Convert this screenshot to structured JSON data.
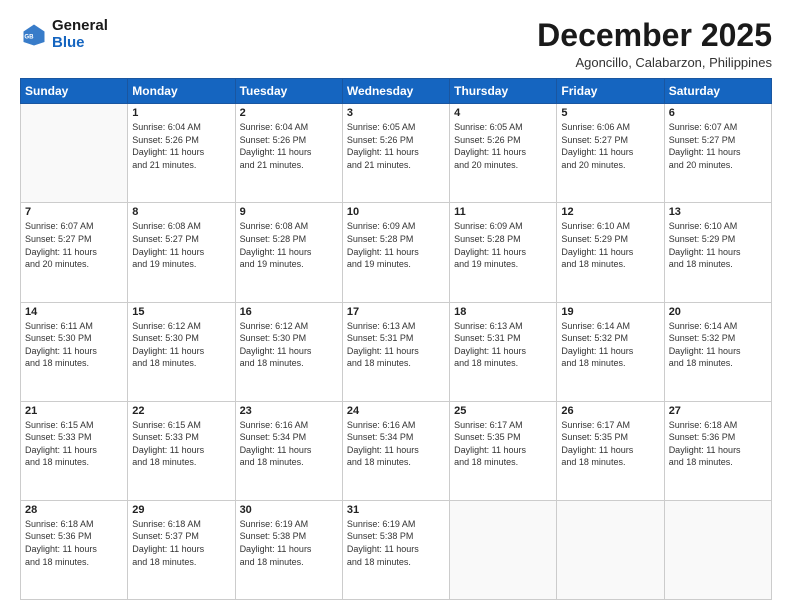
{
  "header": {
    "logo_general": "General",
    "logo_blue": "Blue",
    "month_title": "December 2025",
    "location": "Agoncillo, Calabarzon, Philippines"
  },
  "days_of_week": [
    "Sunday",
    "Monday",
    "Tuesday",
    "Wednesday",
    "Thursday",
    "Friday",
    "Saturday"
  ],
  "weeks": [
    [
      {
        "day": "",
        "info": ""
      },
      {
        "day": "1",
        "info": "Sunrise: 6:04 AM\nSunset: 5:26 PM\nDaylight: 11 hours\nand 21 minutes."
      },
      {
        "day": "2",
        "info": "Sunrise: 6:04 AM\nSunset: 5:26 PM\nDaylight: 11 hours\nand 21 minutes."
      },
      {
        "day": "3",
        "info": "Sunrise: 6:05 AM\nSunset: 5:26 PM\nDaylight: 11 hours\nand 21 minutes."
      },
      {
        "day": "4",
        "info": "Sunrise: 6:05 AM\nSunset: 5:26 PM\nDaylight: 11 hours\nand 20 minutes."
      },
      {
        "day": "5",
        "info": "Sunrise: 6:06 AM\nSunset: 5:27 PM\nDaylight: 11 hours\nand 20 minutes."
      },
      {
        "day": "6",
        "info": "Sunrise: 6:07 AM\nSunset: 5:27 PM\nDaylight: 11 hours\nand 20 minutes."
      }
    ],
    [
      {
        "day": "7",
        "info": "Sunrise: 6:07 AM\nSunset: 5:27 PM\nDaylight: 11 hours\nand 20 minutes."
      },
      {
        "day": "8",
        "info": "Sunrise: 6:08 AM\nSunset: 5:27 PM\nDaylight: 11 hours\nand 19 minutes."
      },
      {
        "day": "9",
        "info": "Sunrise: 6:08 AM\nSunset: 5:28 PM\nDaylight: 11 hours\nand 19 minutes."
      },
      {
        "day": "10",
        "info": "Sunrise: 6:09 AM\nSunset: 5:28 PM\nDaylight: 11 hours\nand 19 minutes."
      },
      {
        "day": "11",
        "info": "Sunrise: 6:09 AM\nSunset: 5:28 PM\nDaylight: 11 hours\nand 19 minutes."
      },
      {
        "day": "12",
        "info": "Sunrise: 6:10 AM\nSunset: 5:29 PM\nDaylight: 11 hours\nand 18 minutes."
      },
      {
        "day": "13",
        "info": "Sunrise: 6:10 AM\nSunset: 5:29 PM\nDaylight: 11 hours\nand 18 minutes."
      }
    ],
    [
      {
        "day": "14",
        "info": "Sunrise: 6:11 AM\nSunset: 5:30 PM\nDaylight: 11 hours\nand 18 minutes."
      },
      {
        "day": "15",
        "info": "Sunrise: 6:12 AM\nSunset: 5:30 PM\nDaylight: 11 hours\nand 18 minutes."
      },
      {
        "day": "16",
        "info": "Sunrise: 6:12 AM\nSunset: 5:30 PM\nDaylight: 11 hours\nand 18 minutes."
      },
      {
        "day": "17",
        "info": "Sunrise: 6:13 AM\nSunset: 5:31 PM\nDaylight: 11 hours\nand 18 minutes."
      },
      {
        "day": "18",
        "info": "Sunrise: 6:13 AM\nSunset: 5:31 PM\nDaylight: 11 hours\nand 18 minutes."
      },
      {
        "day": "19",
        "info": "Sunrise: 6:14 AM\nSunset: 5:32 PM\nDaylight: 11 hours\nand 18 minutes."
      },
      {
        "day": "20",
        "info": "Sunrise: 6:14 AM\nSunset: 5:32 PM\nDaylight: 11 hours\nand 18 minutes."
      }
    ],
    [
      {
        "day": "21",
        "info": "Sunrise: 6:15 AM\nSunset: 5:33 PM\nDaylight: 11 hours\nand 18 minutes."
      },
      {
        "day": "22",
        "info": "Sunrise: 6:15 AM\nSunset: 5:33 PM\nDaylight: 11 hours\nand 18 minutes."
      },
      {
        "day": "23",
        "info": "Sunrise: 6:16 AM\nSunset: 5:34 PM\nDaylight: 11 hours\nand 18 minutes."
      },
      {
        "day": "24",
        "info": "Sunrise: 6:16 AM\nSunset: 5:34 PM\nDaylight: 11 hours\nand 18 minutes."
      },
      {
        "day": "25",
        "info": "Sunrise: 6:17 AM\nSunset: 5:35 PM\nDaylight: 11 hours\nand 18 minutes."
      },
      {
        "day": "26",
        "info": "Sunrise: 6:17 AM\nSunset: 5:35 PM\nDaylight: 11 hours\nand 18 minutes."
      },
      {
        "day": "27",
        "info": "Sunrise: 6:18 AM\nSunset: 5:36 PM\nDaylight: 11 hours\nand 18 minutes."
      }
    ],
    [
      {
        "day": "28",
        "info": "Sunrise: 6:18 AM\nSunset: 5:36 PM\nDaylight: 11 hours\nand 18 minutes."
      },
      {
        "day": "29",
        "info": "Sunrise: 6:18 AM\nSunset: 5:37 PM\nDaylight: 11 hours\nand 18 minutes."
      },
      {
        "day": "30",
        "info": "Sunrise: 6:19 AM\nSunset: 5:38 PM\nDaylight: 11 hours\nand 18 minutes."
      },
      {
        "day": "31",
        "info": "Sunrise: 6:19 AM\nSunset: 5:38 PM\nDaylight: 11 hours\nand 18 minutes."
      },
      {
        "day": "",
        "info": ""
      },
      {
        "day": "",
        "info": ""
      },
      {
        "day": "",
        "info": ""
      }
    ]
  ]
}
